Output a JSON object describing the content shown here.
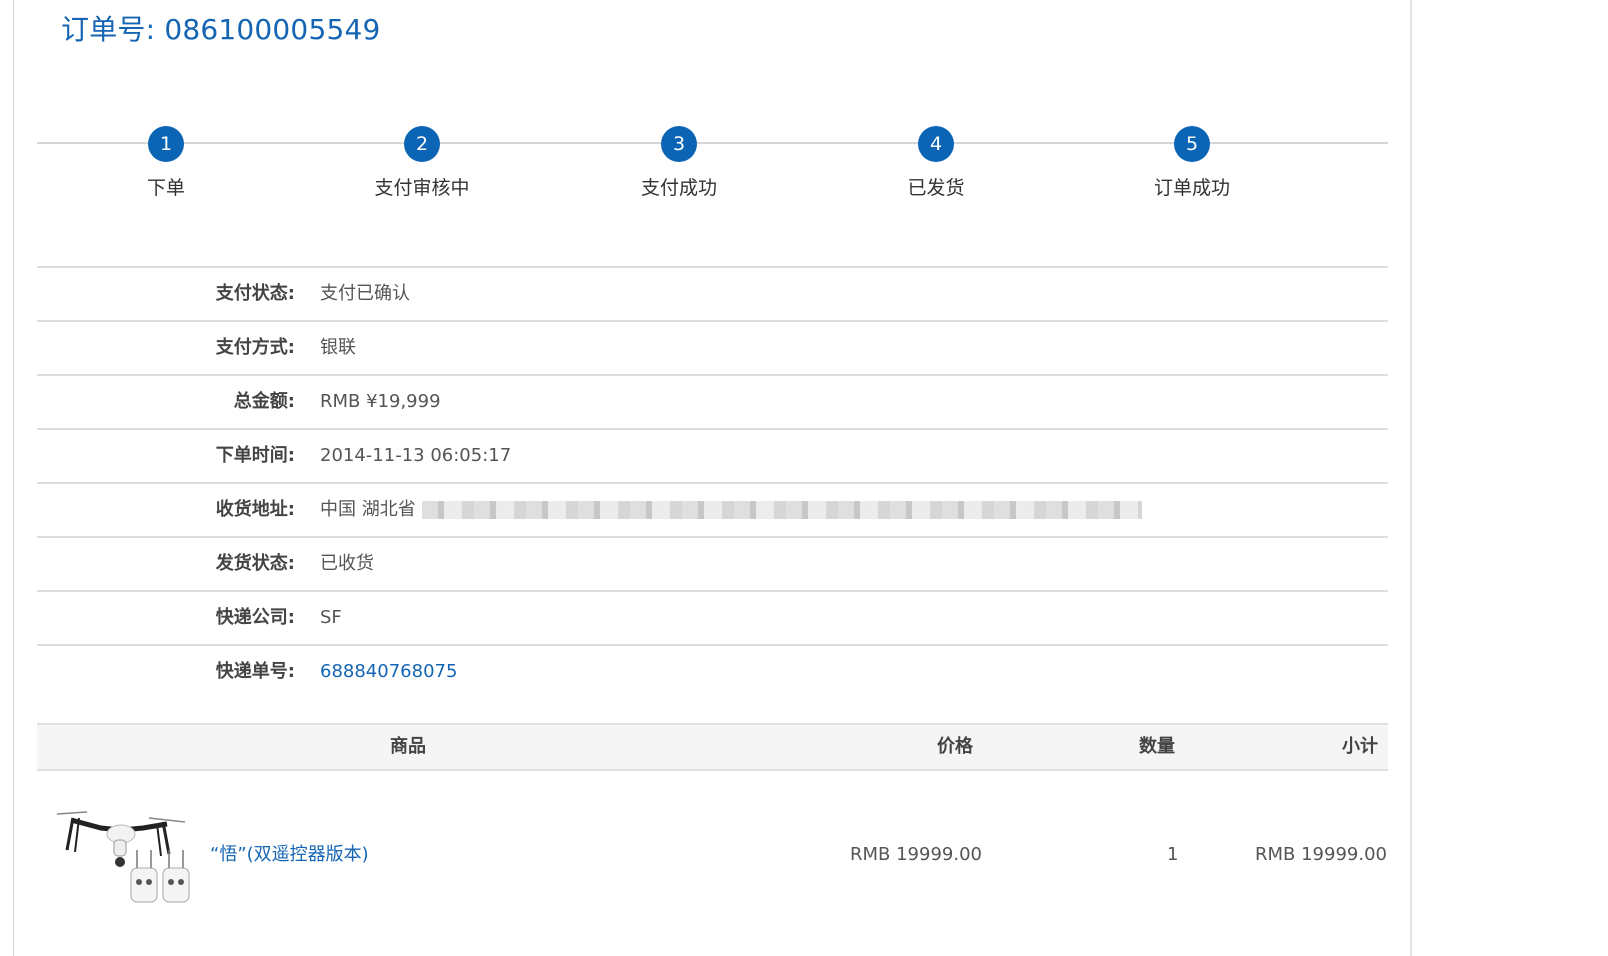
{
  "order": {
    "title": "订单号: 086100005549"
  },
  "steps": [
    {
      "num": "1",
      "label": "下单"
    },
    {
      "num": "2",
      "label": "支付审核中"
    },
    {
      "num": "3",
      "label": "支付成功"
    },
    {
      "num": "4",
      "label": "已发货"
    },
    {
      "num": "5",
      "label": "订单成功"
    }
  ],
  "info": {
    "payment_status": {
      "label": "支付状态:",
      "value": "支付已确认"
    },
    "payment_method": {
      "label": "支付方式:",
      "value": "银联"
    },
    "total_amount": {
      "label": "总金额:",
      "value": "RMB ¥19,999"
    },
    "order_time": {
      "label": "下单时间:",
      "value": "2014-11-13 06:05:17"
    },
    "shipping_address": {
      "label": "收货地址:",
      "value": "中国 湖北省"
    },
    "shipping_status": {
      "label": "发货状态:",
      "value": "已收货"
    },
    "courier": {
      "label": "快递公司:",
      "value": "SF"
    },
    "tracking_number": {
      "label": "快递单号:",
      "value": "688840768075"
    }
  },
  "goods_table": {
    "headers": {
      "product": "商品",
      "price": "价格",
      "quantity": "数量",
      "subtotal": "小计"
    },
    "rows": [
      {
        "name": "“悟”(双遥控器版本)",
        "price": "RMB 19999.00",
        "quantity": "1",
        "subtotal": "RMB 19999.00",
        "image_icon": "drone-icon"
      }
    ]
  },
  "colors": {
    "accent": "#1565b4",
    "step_circle": "#0b64b4",
    "divider": "#dedede",
    "header_bg": "#f5f5f5"
  }
}
